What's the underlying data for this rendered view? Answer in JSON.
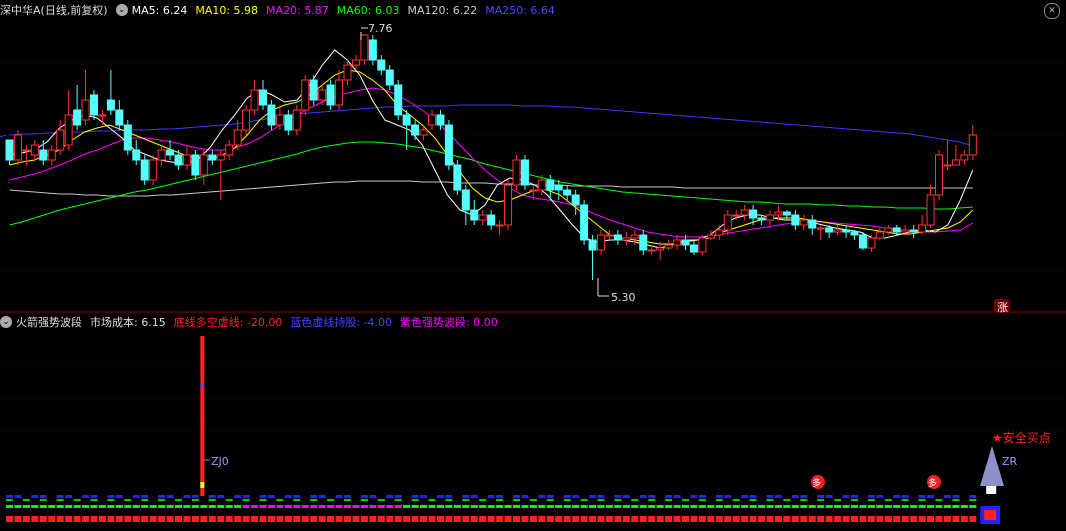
{
  "upper_header": {
    "title": "深中华A(日线,前复权)",
    "ma5": "MA5: 6.24",
    "ma10": "MA10: 5.98",
    "ma20": "MA20: 5.87",
    "ma60": "MA60: 6.03",
    "ma120": "MA120: 6.22",
    "ma250": "MA250: 6.64"
  },
  "lower_header": {
    "title": "火箭强势波段",
    "cost": "市场成本: 6.15",
    "bottom_line": "底线多空虚线: -20.00",
    "blue_line": "蓝色虚线持股: -4.00",
    "purple_band": "紫色强势波段: 0.00"
  },
  "annotations": {
    "high": "7.76",
    "low": "5.30",
    "zhang": "涨",
    "zj0": "ZJ0",
    "zr": "ZR",
    "buy_point": "★安全买点",
    "duo": "多"
  },
  "icons": {
    "collapse": "chevron-down-icon",
    "close": "close-icon"
  },
  "colors": {
    "up": "#ff3333",
    "down": "#54ffff",
    "ma5": "#ffffff",
    "ma10": "#ffff00",
    "ma20": "#ff00ff",
    "ma60": "#00ff00",
    "ma120": "#c8c8c8",
    "ma250": "#3a3aff"
  },
  "chart_data": {
    "type": "candlestick",
    "price_range": [
      5.1,
      7.9
    ],
    "candles": [
      [
        6.7,
        6.5,
        6.7,
        6.45
      ],
      [
        6.5,
        6.75,
        6.8,
        6.45
      ],
      [
        6.6,
        6.6,
        6.65,
        6.45
      ],
      [
        6.55,
        6.65,
        6.7,
        6.5
      ],
      [
        6.6,
        6.5,
        6.7,
        6.45
      ],
      [
        6.5,
        6.6,
        6.65,
        6.45
      ],
      [
        6.6,
        6.8,
        6.9,
        6.55
      ],
      [
        6.65,
        6.95,
        7.2,
        6.6
      ],
      [
        7.0,
        6.85,
        7.25,
        6.8
      ],
      [
        6.9,
        7.1,
        7.4,
        6.85
      ],
      [
        7.15,
        6.95,
        7.2,
        6.9
      ],
      [
        6.95,
        6.95,
        7.0,
        6.85
      ],
      [
        7.1,
        7.0,
        7.4,
        6.95
      ],
      [
        7.0,
        6.85,
        7.1,
        6.8
      ],
      [
        6.85,
        6.6,
        6.9,
        6.55
      ],
      [
        6.6,
        6.5,
        6.7,
        6.45
      ],
      [
        6.5,
        6.3,
        6.55,
        6.25
      ],
      [
        6.3,
        6.5,
        6.55,
        6.25
      ],
      [
        6.5,
        6.6,
        6.65,
        6.45
      ],
      [
        6.6,
        6.55,
        6.7,
        6.5
      ],
      [
        6.55,
        6.45,
        6.6,
        6.4
      ],
      [
        6.45,
        6.55,
        6.65,
        6.4
      ],
      [
        6.55,
        6.35,
        6.6,
        6.3
      ],
      [
        6.35,
        6.55,
        6.6,
        6.25
      ],
      [
        6.55,
        6.5,
        6.6,
        6.45
      ],
      [
        6.5,
        6.55,
        6.6,
        6.1
      ],
      [
        6.55,
        6.65,
        6.7,
        6.5
      ],
      [
        6.65,
        6.8,
        6.9,
        6.6
      ],
      [
        6.8,
        7.0,
        7.05,
        6.75
      ],
      [
        7.0,
        7.2,
        7.3,
        6.95
      ],
      [
        7.2,
        7.05,
        7.3,
        7.0
      ],
      [
        7.05,
        6.85,
        7.1,
        6.8
      ],
      [
        6.85,
        6.95,
        7.05,
        6.8
      ],
      [
        6.95,
        6.8,
        7.0,
        6.75
      ],
      [
        6.8,
        7.0,
        7.05,
        6.75
      ],
      [
        7.0,
        7.3,
        7.35,
        6.95
      ],
      [
        7.3,
        7.1,
        7.35,
        7.05
      ],
      [
        7.1,
        7.2,
        7.25,
        7.05
      ],
      [
        7.25,
        7.05,
        7.3,
        7.0
      ],
      [
        7.05,
        7.3,
        7.4,
        7.0
      ],
      [
        7.3,
        7.45,
        7.5,
        7.25
      ],
      [
        7.45,
        7.5,
        7.55,
        7.4
      ],
      [
        7.5,
        7.75,
        7.76,
        7.45
      ],
      [
        7.7,
        7.5,
        7.75,
        7.45
      ],
      [
        7.5,
        7.4,
        7.55,
        7.35
      ],
      [
        7.4,
        7.25,
        7.45,
        7.2
      ],
      [
        7.25,
        6.95,
        7.3,
        6.9
      ],
      [
        6.95,
        6.85,
        7.0,
        6.6
      ],
      [
        6.85,
        6.75,
        6.9,
        6.7
      ],
      [
        6.75,
        6.8,
        6.85,
        6.7
      ],
      [
        6.85,
        6.95,
        7.0,
        6.8
      ],
      [
        6.95,
        6.85,
        7.0,
        6.8
      ],
      [
        6.85,
        6.45,
        6.9,
        6.4
      ],
      [
        6.45,
        6.2,
        6.5,
        6.15
      ],
      [
        6.2,
        6.0,
        6.25,
        5.85
      ],
      [
        6.0,
        5.9,
        6.1,
        5.85
      ],
      [
        5.9,
        5.95,
        6.0,
        5.85
      ],
      [
        5.95,
        5.85,
        6.0,
        5.8
      ],
      [
        5.85,
        5.85,
        5.9,
        5.75
      ],
      [
        5.85,
        6.25,
        6.3,
        5.8
      ],
      [
        6.25,
        6.5,
        6.55,
        6.2
      ],
      [
        6.5,
        6.25,
        6.55,
        6.2
      ],
      [
        6.2,
        6.2,
        6.25,
        6.1
      ],
      [
        6.2,
        6.3,
        6.35,
        6.15
      ],
      [
        6.3,
        6.2,
        6.35,
        6.1
      ],
      [
        6.25,
        6.2,
        6.3,
        6.1
      ],
      [
        6.2,
        6.15,
        6.25,
        6.1
      ],
      [
        6.15,
        6.05,
        6.2,
        5.95
      ],
      [
        6.05,
        5.7,
        6.1,
        5.65
      ],
      [
        5.7,
        5.6,
        5.75,
        5.3
      ],
      [
        5.6,
        5.75,
        5.8,
        5.55
      ],
      [
        5.75,
        5.75,
        5.8,
        5.7
      ],
      [
        5.75,
        5.7,
        5.8,
        5.65
      ],
      [
        5.7,
        5.72,
        5.78,
        5.65
      ],
      [
        5.72,
        5.75,
        5.8,
        5.65
      ],
      [
        5.75,
        5.6,
        5.8,
        5.55
      ],
      [
        5.6,
        5.6,
        5.65,
        5.55
      ],
      [
        5.6,
        5.62,
        5.68,
        5.5
      ],
      [
        5.62,
        5.65,
        5.7,
        5.6
      ],
      [
        5.65,
        5.7,
        5.75,
        5.6
      ],
      [
        5.7,
        5.65,
        5.75,
        5.6
      ],
      [
        5.65,
        5.58,
        5.7,
        5.55
      ],
      [
        5.58,
        5.72,
        5.75,
        5.55
      ],
      [
        5.72,
        5.75,
        5.8,
        5.7
      ],
      [
        5.75,
        5.8,
        5.85,
        5.7
      ],
      [
        5.8,
        5.95,
        6.0,
        5.75
      ],
      [
        5.95,
        5.95,
        6.0,
        5.9
      ],
      [
        5.95,
        6.0,
        6.05,
        5.9
      ],
      [
        6.0,
        5.92,
        6.05,
        5.85
      ],
      [
        5.92,
        5.9,
        5.95,
        5.85
      ],
      [
        5.9,
        5.95,
        6.0,
        5.85
      ],
      [
        5.95,
        5.98,
        6.05,
        5.9
      ],
      [
        5.98,
        5.95,
        6.0,
        5.9
      ],
      [
        5.95,
        5.85,
        6.0,
        5.8
      ],
      [
        5.85,
        5.9,
        5.95,
        5.8
      ],
      [
        5.9,
        5.82,
        5.95,
        5.75
      ],
      [
        5.82,
        5.82,
        5.85,
        5.7
      ],
      [
        5.82,
        5.78,
        5.85,
        5.72
      ],
      [
        5.78,
        5.8,
        5.85,
        5.75
      ],
      [
        5.8,
        5.78,
        5.85,
        5.72
      ],
      [
        5.78,
        5.75,
        5.8,
        5.7
      ],
      [
        5.75,
        5.62,
        5.78,
        5.6
      ],
      [
        5.62,
        5.72,
        5.75,
        5.58
      ],
      [
        5.72,
        5.78,
        5.82,
        5.7
      ],
      [
        5.78,
        5.82,
        5.85,
        5.75
      ],
      [
        5.82,
        5.78,
        5.85,
        5.75
      ],
      [
        5.78,
        5.8,
        5.85,
        5.75
      ],
      [
        5.8,
        5.78,
        5.85,
        5.72
      ],
      [
        5.78,
        5.85,
        5.95,
        5.75
      ],
      [
        5.85,
        6.15,
        6.25,
        5.82
      ],
      [
        6.15,
        6.55,
        6.6,
        6.1
      ],
      [
        6.45,
        6.45,
        6.7,
        6.4
      ],
      [
        6.45,
        6.5,
        6.65,
        6.45
      ],
      [
        6.5,
        6.55,
        6.6,
        6.45
      ],
      [
        6.55,
        6.75,
        6.85,
        6.5
      ]
    ],
    "lines": {
      "ma5": [
        6.55,
        6.57,
        6.6,
        6.68,
        6.82,
        6.9,
        6.95,
        6.92,
        6.82,
        6.72,
        6.6,
        6.55,
        6.5,
        6.48,
        6.46,
        6.5,
        6.62,
        6.8,
        6.95,
        7.12,
        7.2,
        7.15,
        7.08,
        7.1,
        7.25,
        7.45,
        7.6,
        7.5,
        7.35,
        7.1,
        6.9,
        6.85,
        6.8,
        6.65,
        6.4,
        6.15,
        6.0,
        5.95,
        6.05,
        6.25,
        6.32,
        6.3,
        6.25,
        6.15,
        6.0,
        5.85,
        5.72,
        5.68,
        5.7,
        5.7,
        5.68,
        5.65,
        5.62,
        5.65,
        5.7,
        5.7,
        5.75,
        5.85,
        5.92,
        5.95,
        5.95,
        5.92,
        5.9,
        5.9,
        5.88,
        5.85,
        5.82,
        5.8,
        5.78,
        5.72,
        5.72,
        5.75,
        5.78,
        5.8,
        5.78,
        5.85,
        6.1,
        6.4
      ],
      "ma10": [
        6.45,
        6.48,
        6.5,
        6.55,
        6.6,
        6.7,
        6.78,
        6.82,
        6.85,
        6.8,
        6.75,
        6.7,
        6.65,
        6.6,
        6.55,
        6.52,
        6.5,
        6.55,
        6.62,
        6.75,
        6.9,
        7.0,
        7.05,
        7.08,
        7.15,
        7.25,
        7.35,
        7.4,
        7.38,
        7.3,
        7.2,
        7.05,
        6.95,
        6.85,
        6.72,
        6.55,
        6.38,
        6.22,
        6.12,
        6.08,
        6.1,
        6.15,
        6.2,
        6.2,
        6.15,
        6.05,
        5.95,
        5.85,
        5.75,
        5.72,
        5.7,
        5.68,
        5.66,
        5.66,
        5.68,
        5.7,
        5.72,
        5.78,
        5.82,
        5.86,
        5.9,
        5.92,
        5.92,
        5.92,
        5.9,
        5.88,
        5.86,
        5.84,
        5.82,
        5.8,
        5.78,
        5.76,
        5.76,
        5.78,
        5.8,
        5.82,
        5.88,
        6.0
      ],
      "ma20": [
        6.3,
        6.33,
        6.36,
        6.4,
        6.45,
        6.5,
        6.56,
        6.6,
        6.65,
        6.7,
        6.72,
        6.72,
        6.7,
        6.68,
        6.65,
        6.62,
        6.6,
        6.6,
        6.62,
        6.66,
        6.72,
        6.8,
        6.88,
        6.95,
        7.02,
        7.08,
        7.13,
        7.17,
        7.2,
        7.22,
        7.2,
        7.15,
        7.08,
        7.0,
        6.9,
        6.78,
        6.65,
        6.52,
        6.4,
        6.3,
        6.22,
        6.15,
        6.12,
        6.1,
        6.08,
        6.05,
        6.0,
        5.95,
        5.9,
        5.86,
        5.82,
        5.78,
        5.76,
        5.74,
        5.73,
        5.73,
        5.74,
        5.76,
        5.78,
        5.8,
        5.82,
        5.84,
        5.86,
        5.87,
        5.88,
        5.88,
        5.87,
        5.86,
        5.85,
        5.84,
        5.82,
        5.8,
        5.79,
        5.78,
        5.78,
        5.79,
        5.8,
        5.87
      ],
      "ma60": [
        5.85,
        5.88,
        5.92,
        5.96,
        6.0,
        6.03,
        6.06,
        6.09,
        6.12,
        6.15,
        6.18,
        6.2,
        6.23,
        6.26,
        6.29,
        6.32,
        6.35,
        6.38,
        6.41,
        6.44,
        6.47,
        6.5,
        6.53,
        6.56,
        6.6,
        6.63,
        6.65,
        6.67,
        6.68,
        6.68,
        6.67,
        6.66,
        6.64,
        6.62,
        6.59,
        6.56,
        6.53,
        6.5,
        6.46,
        6.43,
        6.4,
        6.37,
        6.34,
        6.31,
        6.28,
        6.26,
        6.24,
        6.22,
        6.2,
        6.18,
        6.17,
        6.16,
        6.15,
        6.14,
        6.13,
        6.12,
        6.11,
        6.1,
        6.09,
        6.08,
        6.08,
        6.07,
        6.06,
        6.06,
        6.06,
        6.05,
        6.05,
        6.04,
        6.04,
        6.03,
        6.03,
        6.02,
        6.02,
        6.02,
        6.01,
        6.01,
        6.02,
        6.03
      ],
      "ma120": [
        6.2,
        6.19,
        6.18,
        6.17,
        6.16,
        6.16,
        6.15,
        6.15,
        6.14,
        6.14,
        6.14,
        6.14,
        6.15,
        6.15,
        6.16,
        6.17,
        6.18,
        6.19,
        6.2,
        6.21,
        6.22,
        6.23,
        6.24,
        6.25,
        6.26,
        6.27,
        6.28,
        6.28,
        6.29,
        6.29,
        6.29,
        6.29,
        6.29,
        6.28,
        6.28,
        6.28,
        6.27,
        6.27,
        6.27,
        6.26,
        6.26,
        6.26,
        6.25,
        6.25,
        6.25,
        6.24,
        6.24,
        6.24,
        6.24,
        6.23,
        6.23,
        6.23,
        6.23,
        6.23,
        6.22,
        6.22,
        6.22,
        6.22,
        6.22,
        6.22,
        6.22,
        6.22,
        6.22,
        6.22,
        6.22,
        6.22,
        6.22,
        6.22,
        6.22,
        6.22,
        6.22,
        6.22,
        6.22,
        6.22,
        6.22,
        6.22,
        6.22,
        6.22
      ],
      "ma250": [
        6.75,
        6.76,
        6.76,
        6.77,
        6.77,
        6.78,
        6.78,
        6.79,
        6.79,
        6.8,
        6.8,
        6.8,
        6.81,
        6.81,
        6.82,
        6.83,
        6.84,
        6.85,
        6.86,
        6.88,
        6.9,
        6.92,
        6.94,
        6.96,
        6.97,
        6.98,
        6.99,
        7.0,
        7.01,
        7.02,
        7.03,
        7.03,
        7.04,
        7.04,
        7.04,
        7.04,
        7.05,
        7.05,
        7.05,
        7.05,
        7.05,
        7.04,
        7.04,
        7.04,
        7.03,
        7.03,
        7.02,
        7.01,
        7.0,
        6.99,
        6.98,
        6.97,
        6.96,
        6.95,
        6.94,
        6.93,
        6.92,
        6.91,
        6.9,
        6.89,
        6.88,
        6.87,
        6.86,
        6.85,
        6.84,
        6.83,
        6.82,
        6.81,
        6.8,
        6.79,
        6.78,
        6.77,
        6.76,
        6.74,
        6.72,
        6.7,
        6.68,
        6.64
      ]
    }
  }
}
